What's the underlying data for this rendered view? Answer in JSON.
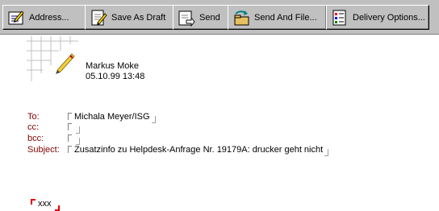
{
  "toolbar": {
    "buttons": [
      {
        "label": "Address...",
        "icon": "address-book-pen-icon"
      },
      {
        "label": "Save As Draft",
        "icon": "save-draft-icon"
      },
      {
        "label": "Send",
        "icon": "send-envelope-icon"
      },
      {
        "label": "Send And File...",
        "icon": "send-and-file-icon"
      },
      {
        "label": "Delivery Options...",
        "icon": "delivery-options-icon"
      }
    ]
  },
  "header": {
    "author": "Markus Moke",
    "datetime": "05.10.99 13:48"
  },
  "fields": {
    "to_label": "To:",
    "to_value": "Michala Meyer/ISG",
    "cc_label": "cc:",
    "cc_value": "",
    "bcc_label": "bcc:",
    "bcc_value": "",
    "subject_label": "Subject:",
    "subject_value": "Zusatzinfo zu Helpdesk-Anfrage Nr. 19179A: drucker geht nicht"
  },
  "body": {
    "text": "xxx"
  },
  "colors": {
    "toolbar_bg": "#c0c0c0",
    "label_color": "#800000",
    "body_marker": "#e00000"
  }
}
